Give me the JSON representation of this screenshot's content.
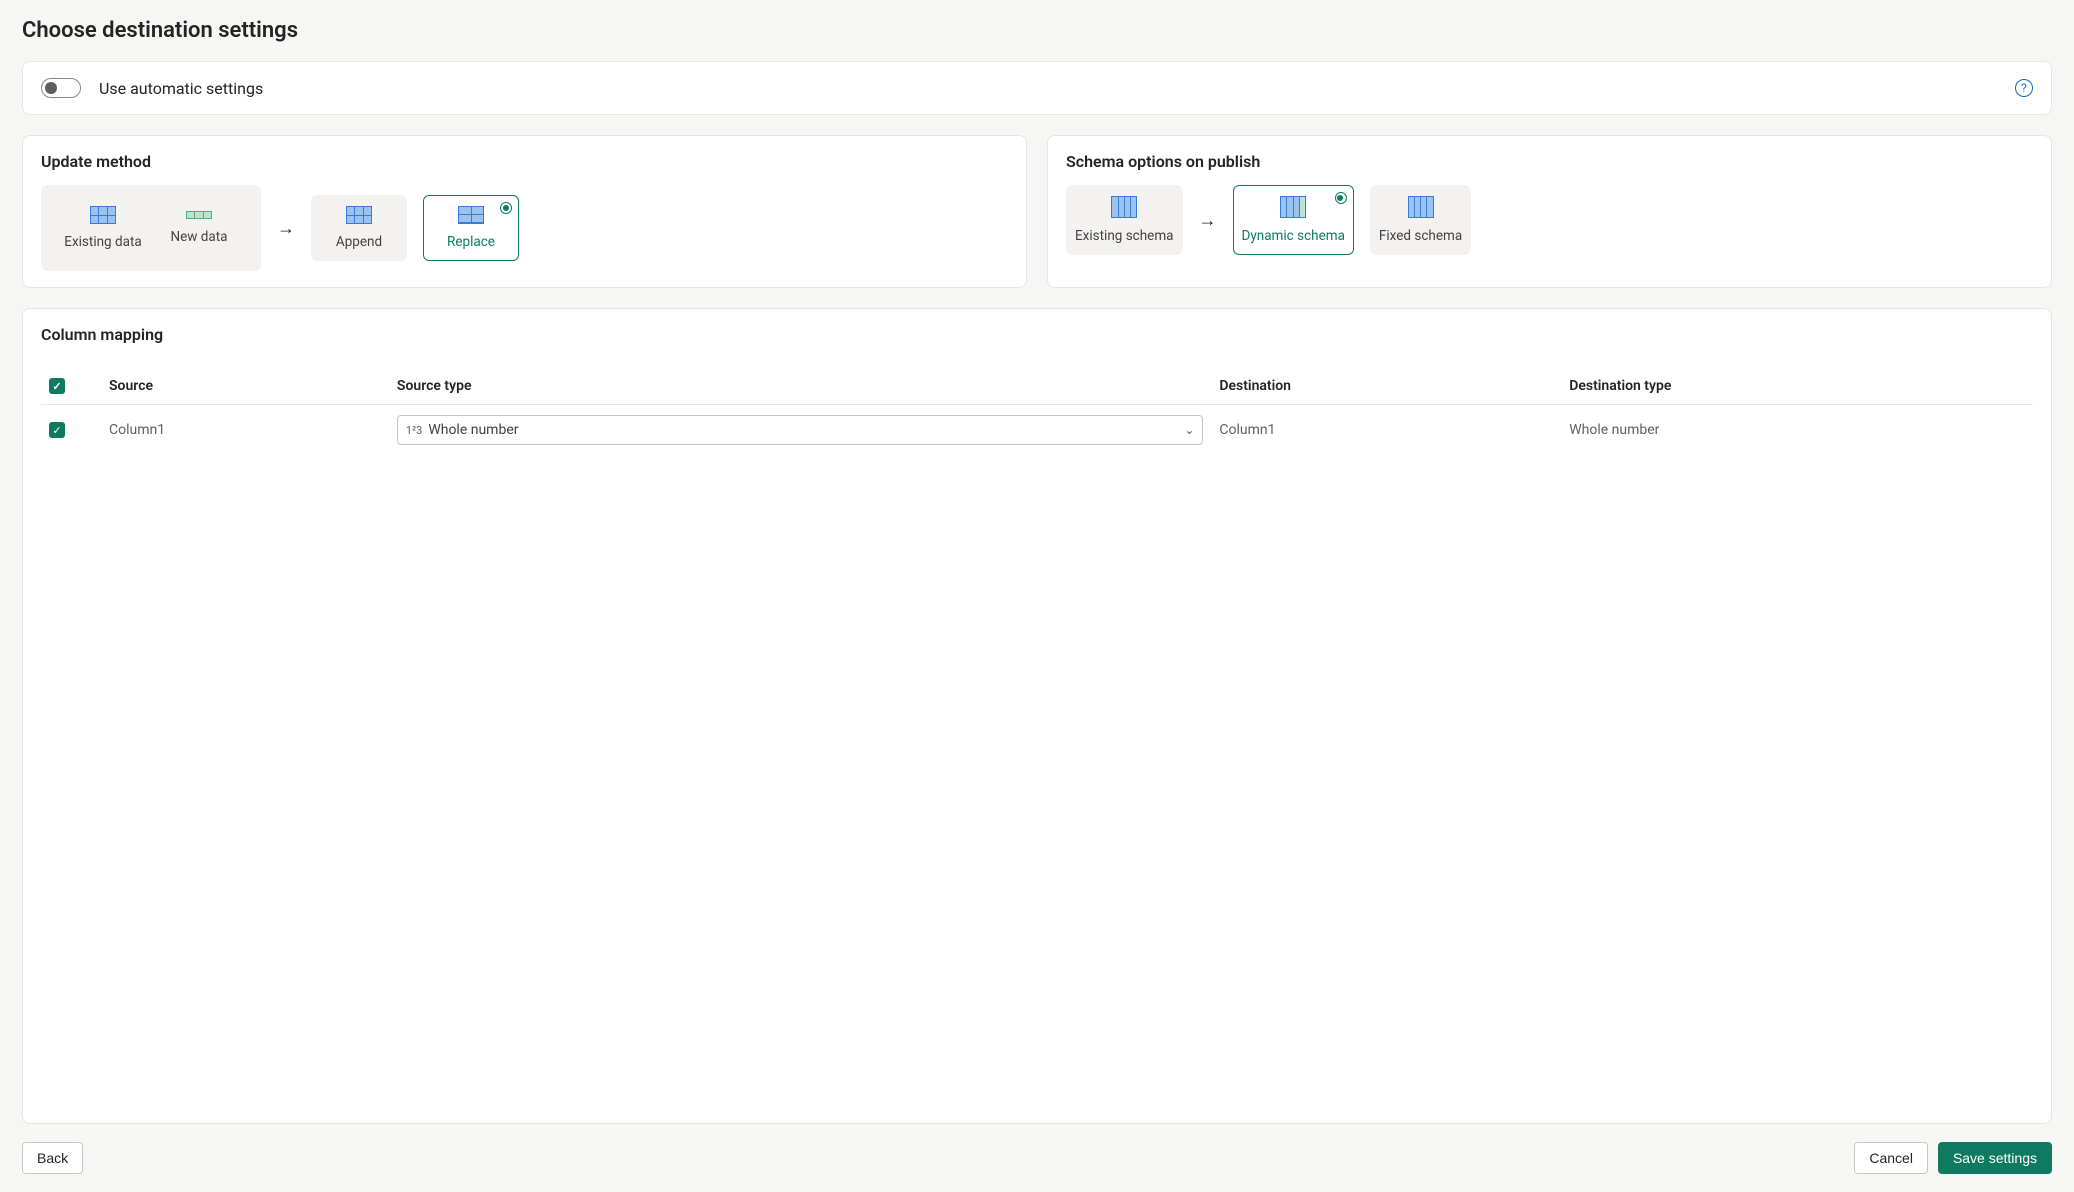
{
  "page": {
    "title": "Choose destination settings"
  },
  "auto": {
    "label": "Use automatic settings",
    "enabled": false
  },
  "updateMethod": {
    "title": "Update method",
    "existingData": "Existing data",
    "newData": "New data",
    "options": {
      "append": "Append",
      "replace": "Replace"
    },
    "selected": "replace"
  },
  "schemaOptions": {
    "title": "Schema options on publish",
    "existingSchema": "Existing schema",
    "options": {
      "dynamic": "Dynamic schema",
      "fixed": "Fixed schema"
    },
    "selected": "dynamic"
  },
  "mapping": {
    "title": "Column mapping",
    "headers": {
      "source": "Source",
      "sourceType": "Source type",
      "destination": "Destination",
      "destinationType": "Destination type"
    },
    "rows": [
      {
        "checked": true,
        "source": "Column1",
        "sourceTypeBadge": "1²3",
        "sourceType": "Whole number",
        "destination": "Column1",
        "destinationType": "Whole number"
      }
    ]
  },
  "footer": {
    "back": "Back",
    "cancel": "Cancel",
    "save": "Save settings"
  }
}
